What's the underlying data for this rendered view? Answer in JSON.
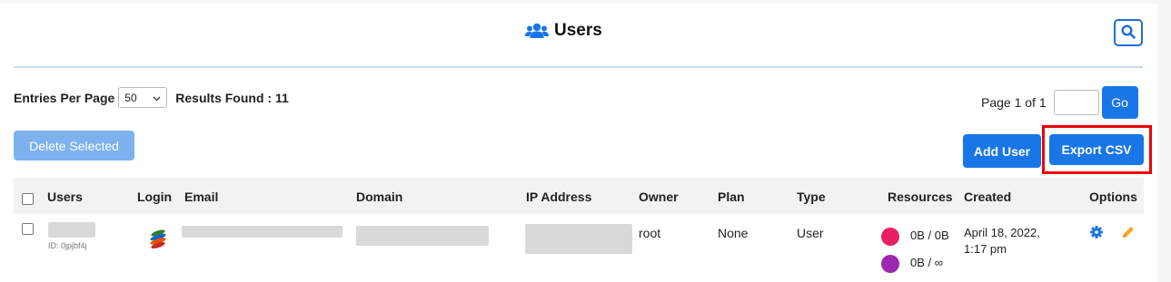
{
  "header": {
    "title": "Users",
    "title_icon": "users-icon",
    "search_icon": "search-icon"
  },
  "toolbar": {
    "entries_label": "Entries Per Page",
    "entries_value": "50",
    "results_label": "Results Found : 11",
    "page_label": "Page 1 of 1",
    "page_input_value": "",
    "go_label": "Go",
    "delete_label": "Delete Selected",
    "add_label": "Add User",
    "export_label": "Export CSV"
  },
  "table": {
    "columns": [
      "Users",
      "Login",
      "Email",
      "Domain",
      "IP Address",
      "Owner",
      "Plan",
      "Type",
      "Resources",
      "Created",
      "Options"
    ],
    "rows": [
      {
        "user_id": "ID: 0jpjbf4j",
        "owner": "root",
        "plan": "None",
        "type": "User",
        "resource_1": "0B / 0B",
        "resource_2": "0B / ∞",
        "created": "April 18, 2022, 1:17 pm"
      }
    ]
  },
  "colors": {
    "primary": "#1976e6",
    "primary_light": "#7eb2ef",
    "highlight": "#ee0000",
    "resource_1_dot": "#e91e63",
    "resource_2_dot": "#9c27b0",
    "edit_icon": "#f5a623"
  }
}
